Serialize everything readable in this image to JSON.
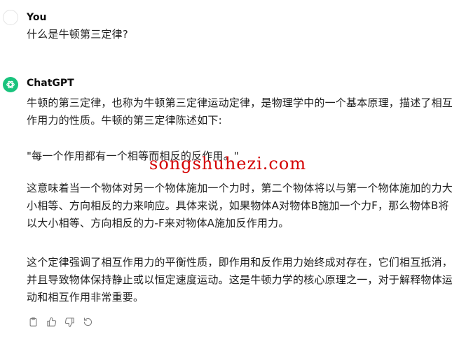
{
  "user": {
    "name": "You",
    "question": "什么是牛顿第三定律?"
  },
  "assistant": {
    "name": "ChatGPT",
    "paragraphs": [
      "牛顿的第三定律，也称为牛顿第三定律运动定律，是物理学中的一个基本原理，描述了相互作用力的性质。牛顿的第三定律陈述如下:",
      "\"每一个作用都有一个相等而相反的反作用。\"",
      "这意味着当一个物体对另一个物体施加一个力时，第二个物体将以与第一个物体施加的力大小相等、方向相反的力来响应。具体来说，如果物体A对物体B施加一个力F，那么物体B将以大小相等、方向相反的力-F来对物体A施加反作用力。",
      "这个定律强调了相互作用力的平衡性质，即作用和反作用力始终成对存在，它们相互抵消，并且导致物体保持静止或以恒定速度运动。这是牛顿力学的核心原理之一，对于解释物体运动和相互作用非常重要。"
    ]
  },
  "watermark": "songshuhezi.com",
  "actions": [
    "clipboard-icon",
    "thumbs-up-icon",
    "thumbs-down-icon",
    "regenerate-icon"
  ]
}
